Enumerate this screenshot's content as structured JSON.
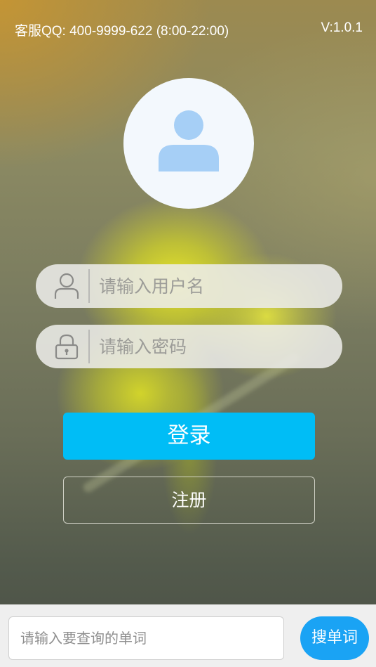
{
  "status_bar": {
    "service_contact": "客服QQ: 400-9999-622 (8:00-22:00)",
    "version": "V:1.0.1"
  },
  "login_form": {
    "avatar_icon": "user-avatar-icon",
    "username_icon": "user-outline-icon",
    "username_placeholder": "请输入用户名",
    "username_value": "",
    "password_icon": "padlock-icon",
    "password_placeholder": "请输入密码",
    "password_value": "",
    "login_label": "登录",
    "register_label": "注册"
  },
  "word_search": {
    "placeholder": "请输入要查询的单词",
    "value": "",
    "button_label": "搜单词"
  },
  "colors": {
    "login_button": "#00bdf6",
    "search_button": "#1aa3f4",
    "avatar_glyph": "#a6cff6"
  }
}
